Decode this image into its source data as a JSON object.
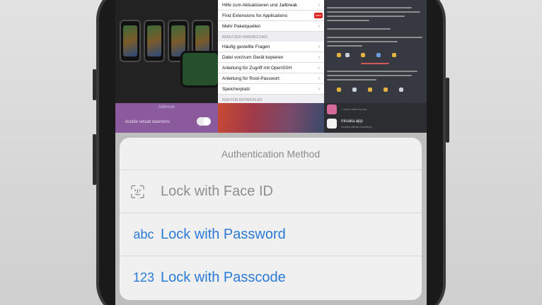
{
  "menu": {
    "rows_top": [
      {
        "label": "Hilfe zum Aktualisieren und Jailbreak"
      },
      {
        "label": "Find Extensions for Applications",
        "badge": "New"
      },
      {
        "label": "Mehr Paketquellen"
      }
    ],
    "section_handbooks": "BENUTZER-HANDBÜCHER",
    "rows_handbooks": [
      {
        "label": "Häufig gestellte Fragen"
      },
      {
        "label": "Datei von/zum Gerät kopieren"
      },
      {
        "label": "Anleitung für Zugriff mit OpenSSH"
      },
      {
        "label": "Anleitung für Root-Passwort"
      },
      {
        "label": "Speicherplatz"
      }
    ],
    "section_dev": "NUR FÜR ENTWICKLER"
  },
  "jailbreak_tile": {
    "title": "Jailbreak",
    "option": "double reload daemons"
  },
  "repo_tile": {
    "app_name": "misaka.app",
    "app_sub": "misaka official repository",
    "top_line": "+ more made by you"
  },
  "auth_sheet": {
    "title": "Authentication Method",
    "options": [
      {
        "icon": "face-id-icon",
        "icon_text": "",
        "label": "Lock with Face ID",
        "enabled": false
      },
      {
        "icon": "abc-icon",
        "icon_text": "abc",
        "label": "Lock with Password",
        "enabled": true
      },
      {
        "icon": "123-icon",
        "icon_text": "123",
        "label": "Lock with Passcode",
        "enabled": true
      }
    ]
  },
  "colors": {
    "accent": "#2a7ad6",
    "disabled": "#8e8e93",
    "sheet_bg": "#f0f0f0"
  }
}
